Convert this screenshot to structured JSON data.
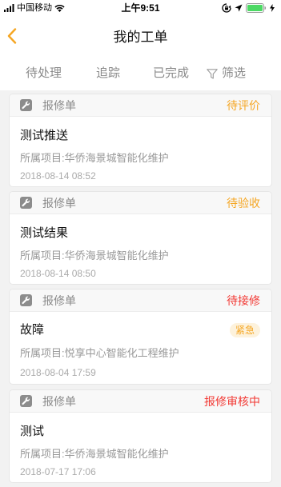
{
  "status_bar": {
    "carrier": "中国移动",
    "time": "上午9:51",
    "icons": [
      "signal-icon",
      "wifi-icon",
      "rotation-lock-icon",
      "location-icon",
      "battery-icon",
      "charging-icon"
    ],
    "battery_color": "#4cd964"
  },
  "nav": {
    "back_icon": "chevron-left-icon",
    "title": "我的工单"
  },
  "tabs": [
    {
      "label": "待处理"
    },
    {
      "label": "追踪"
    },
    {
      "label": "已完成"
    },
    {
      "label": "筛选",
      "icon": "filter-icon"
    }
  ],
  "orders": [
    {
      "icon": "wrench-icon",
      "type": "报修单",
      "status": "待评价",
      "status_color": "#f5a623",
      "title": "测试推送",
      "project": "所属项目:华侨海景城智能化维护",
      "time": "2018-08-14 08:52"
    },
    {
      "icon": "wrench-icon",
      "type": "报修单",
      "status": "待验收",
      "status_color": "#f5a623",
      "title": "测试结果",
      "project": "所属项目:华侨海景城智能化维护",
      "time": "2018-08-14 08:50"
    },
    {
      "icon": "wrench-icon",
      "type": "报修单",
      "status": "待接修",
      "status_color": "#f23a35",
      "title": "故障",
      "badge": "紧急",
      "project": "所属项目:悦享中心智能化工程维护",
      "time": "2018-08-04 17:59"
    },
    {
      "icon": "wrench-icon",
      "type": "报修单",
      "status": "报修审核中",
      "status_color": "#f23a35",
      "title": "测试",
      "project": "所属项目:华侨海景城智能化维护",
      "time": "2018-07-17 17:06"
    }
  ],
  "colors": {
    "accent": "#f5a623",
    "urgent": "#f23a35",
    "badge_bg": "#fdf2dc",
    "background": "#f2f2f2"
  }
}
